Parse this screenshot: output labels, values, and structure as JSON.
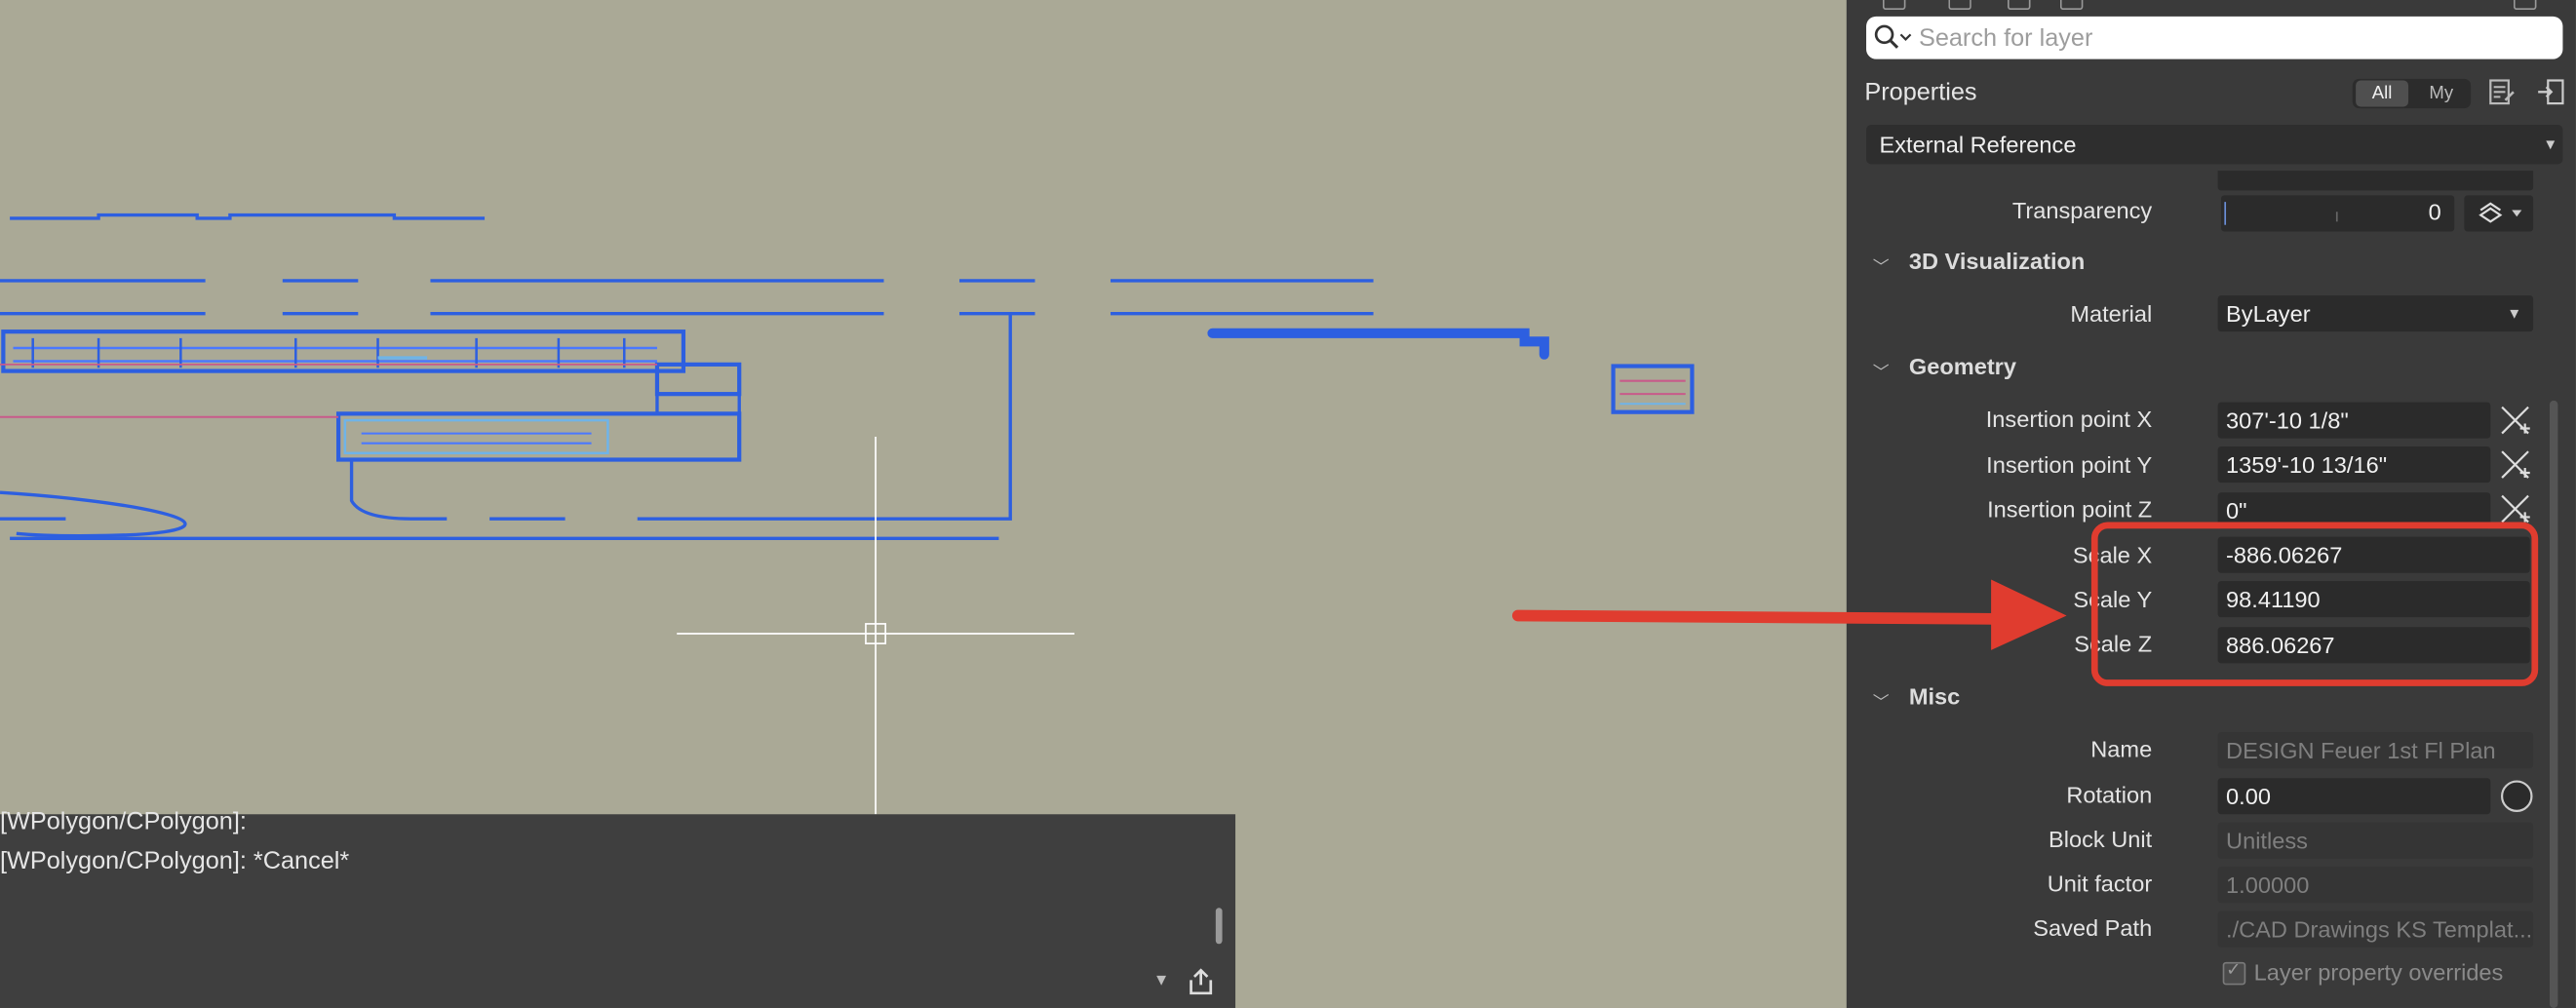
{
  "search": {
    "placeholder": "Search for layer"
  },
  "properties": {
    "title": "Properties",
    "filter_all": "All",
    "filter_my": "My",
    "object_type": "External Reference",
    "transparency": {
      "label": "Transparency",
      "value": "0"
    },
    "sections": {
      "visualization": "3D Visualization",
      "geometry": "Geometry",
      "misc": "Misc"
    },
    "material": {
      "label": "Material",
      "value": "ByLayer"
    },
    "geometry": {
      "insertion_x": {
        "label": "Insertion point X",
        "value": "307'-10 1/8\""
      },
      "insertion_y": {
        "label": "Insertion point Y",
        "value": "1359'-10 13/16\""
      },
      "insertion_z": {
        "label": "Insertion point Z",
        "value": "0\""
      },
      "scale_x": {
        "label": "Scale X",
        "value": "-886.06267"
      },
      "scale_y": {
        "label": "Scale Y",
        "value": "98.41190"
      },
      "scale_z": {
        "label": "Scale Z",
        "value": "886.06267"
      }
    },
    "misc": {
      "name": {
        "label": "Name",
        "value": "DESIGN Feuer 1st Fl Plan"
      },
      "rotation": {
        "label": "Rotation",
        "value": "0.00"
      },
      "block_unit": {
        "label": "Block Unit",
        "value": "Unitless"
      },
      "unit_factor": {
        "label": "Unit factor",
        "value": "1.00000"
      },
      "saved_path": {
        "label": "Saved Path",
        "value": "./CAD Drawings KS Templat..."
      },
      "layer_overrides": "Layer property overrides"
    }
  },
  "command_line": {
    "line1": "[WPolygon/CPolygon]:",
    "line2": "[WPolygon/CPolygon]: *Cancel*"
  },
  "colors": {
    "canvas": "#aaa996",
    "panel": "#3a3a3a",
    "command_bg": "#3f3f3f",
    "annotation_red": "#e03c2f",
    "geometry_blue": "#2d5fe0"
  }
}
